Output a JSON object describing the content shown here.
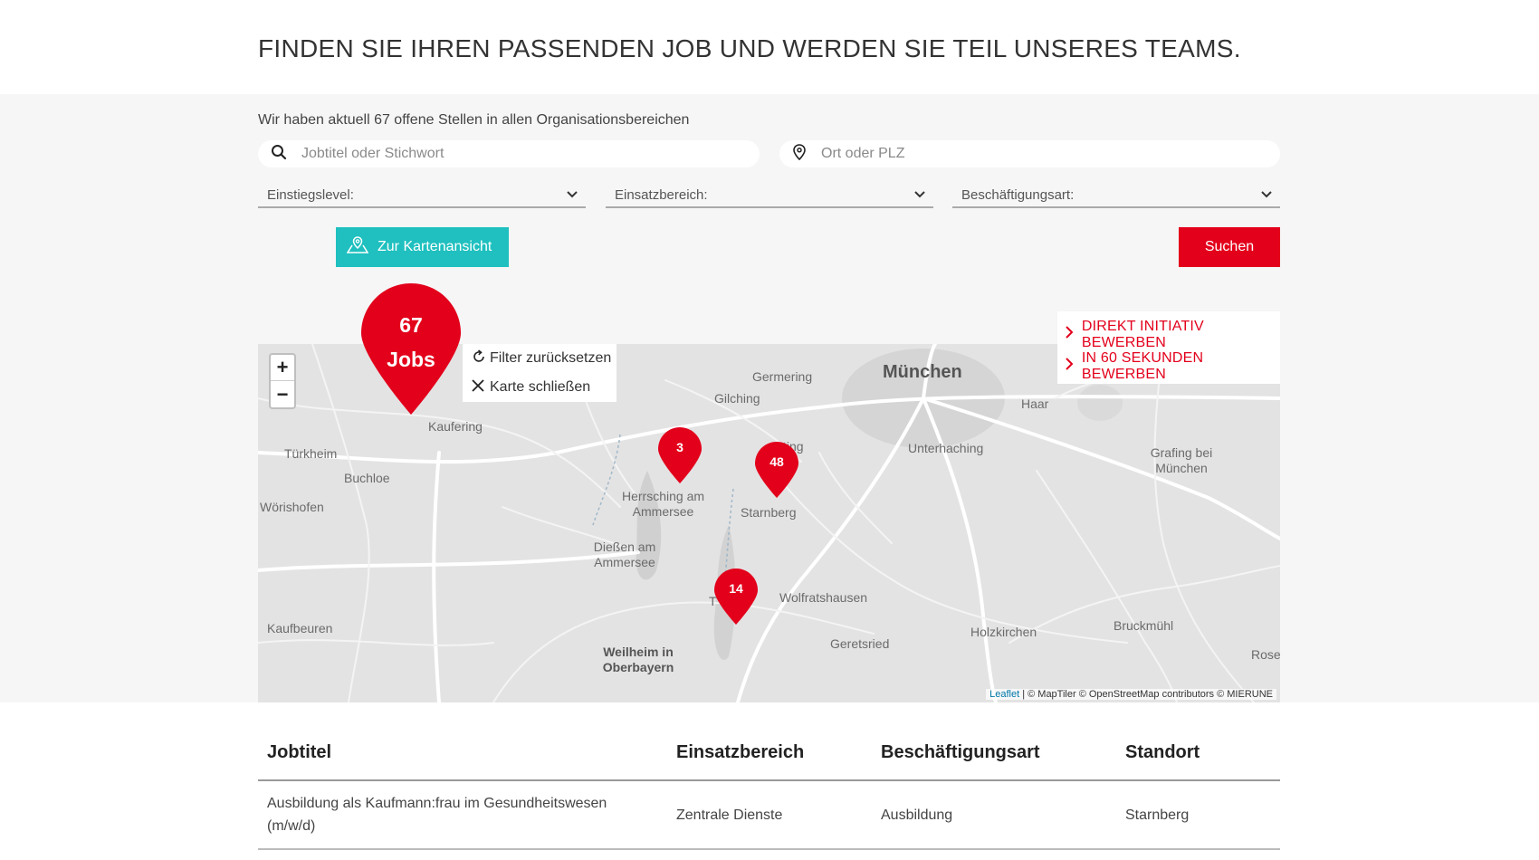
{
  "header": {
    "title": "FINDEN SIE IHREN PASSENDEN JOB UND WERDEN SIE TEIL UNSERES TEAMS."
  },
  "search": {
    "intro": "Wir haben aktuell 67 offene Stellen in allen Organisationsbereichen",
    "keyword_placeholder": "Jobtitel oder Stichwort",
    "location_placeholder": "Ort oder PLZ",
    "filters": [
      "Einstiegslevel:",
      "Einsatzbereich:",
      "Beschäftigungsart:"
    ],
    "map_button": "Zur Kartenansicht",
    "search_button": "Suchen"
  },
  "map": {
    "total_pin": {
      "count": "67",
      "label": "Jobs"
    },
    "pins": [
      {
        "count": "3"
      },
      {
        "count": "48"
      },
      {
        "count": "14"
      }
    ],
    "zoom_in": "+",
    "zoom_out": "−",
    "panel": {
      "reset": "Filter zurücksetzen",
      "close": "Karte schließen"
    },
    "side_links": [
      "DIREKT INITIATIV BEWERBEN",
      "IN 60 SEKUNDEN BEWERBEN"
    ],
    "places": [
      "München",
      "Germering",
      "Gilching",
      "Haar",
      "Kaufering",
      "Türkheim",
      "Buchloe",
      "Unterhaching",
      "Grafing bei München",
      "Herrsching am Ammersee",
      "Starnberg",
      "Wörishofen",
      "Dießen am Ammersee",
      "Wolfratshausen",
      "Kaufbeuren",
      "Weilheim in Oberbayern",
      "Geretsried",
      "Holzkirchen",
      "Bruckmühl",
      "Rose",
      "ting",
      "T"
    ],
    "attribution": {
      "leaflet": "Leaflet",
      "rest": "| © MapTiler © OpenStreetMap contributors © MIERUNE"
    },
    "colors": {
      "pin": "#e3001b",
      "teal": "#1fc0bf"
    }
  },
  "table": {
    "headers": [
      "Jobtitel",
      "Einsatzbereich",
      "Beschäftigungsart",
      "Standort"
    ],
    "rows": [
      {
        "title": "Ausbildung als Kaufmann:frau im Gesundheitswesen (m/w/d)",
        "area": "Zentrale Dienste",
        "type": "Ausbildung",
        "location": "Starnberg"
      }
    ]
  }
}
